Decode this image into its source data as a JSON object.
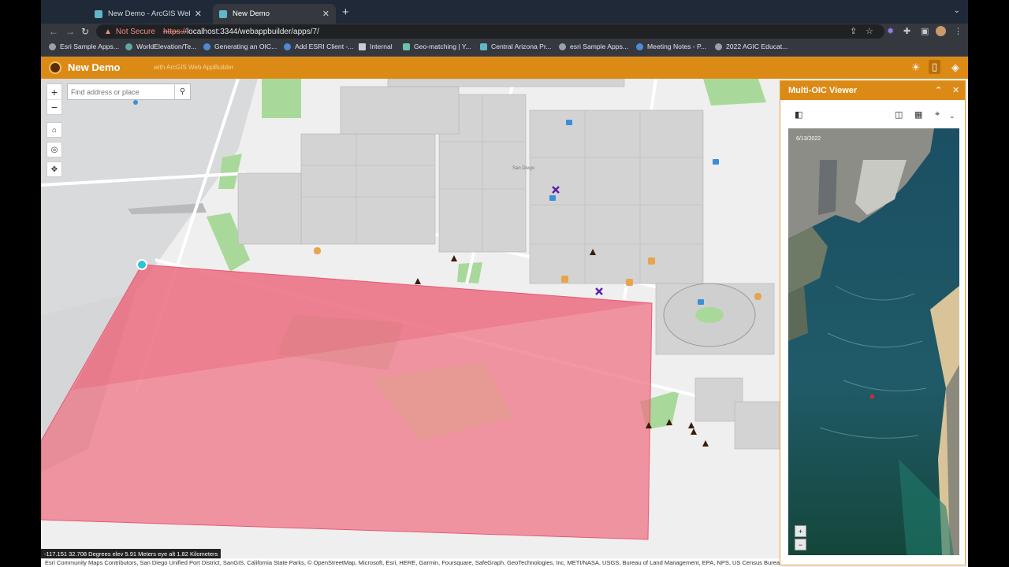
{
  "browser": {
    "tabs": [
      {
        "title": "New Demo - ArcGIS Web AppB",
        "active": false
      },
      {
        "title": "New Demo",
        "active": true
      }
    ],
    "security_label": "Not Secure",
    "url_scheme": "https://",
    "url_rest": "localhost:3344/webappbuilder/apps/7/",
    "bookmarks": [
      "Esri Sample Apps...",
      "WorldElevation/Te...",
      "Generating an OIC...",
      "Add ESRI Client -...",
      "Internal",
      "Geo-matching | Y...",
      "Central Arizona Pr...",
      "esri Sample Apps...",
      "Meeting Notes - P...",
      "2022 AGIC Educat..."
    ]
  },
  "app": {
    "title": "New Demo",
    "subtitle": "with ArcGIS Web AppBuilder",
    "accent": "#dc8a16"
  },
  "map": {
    "search_placeholder": "Find address or place",
    "street_label": "San Diego",
    "coords_readout": "-117.151 32.708 Degrees    elev 5.91 Meters    eye alt 1.82 Kilometers",
    "attribution": "Esri Community Maps Contributors, San Diego Unified Port District, SanGIS, California State Parks, © OpenStreetMap, Microsoft, Esri, HERE, Garmin, Foursquare, SafeGraph, GeoTechnologies, Inc, METI/NASA, USGS, Bureau of Land Management, EPA, NPS, US Census Bureau, USDA",
    "footprint_color": "#ee6f81",
    "controls": [
      "zoom-in",
      "zoom-out",
      "home",
      "locate",
      "pan"
    ]
  },
  "panel": {
    "title": "Multi-OIC Viewer",
    "image_date": "6/13/2022",
    "tool_icons": [
      "camera-icon",
      "layers-icon",
      "image-icon",
      "crosshair-icon"
    ]
  }
}
